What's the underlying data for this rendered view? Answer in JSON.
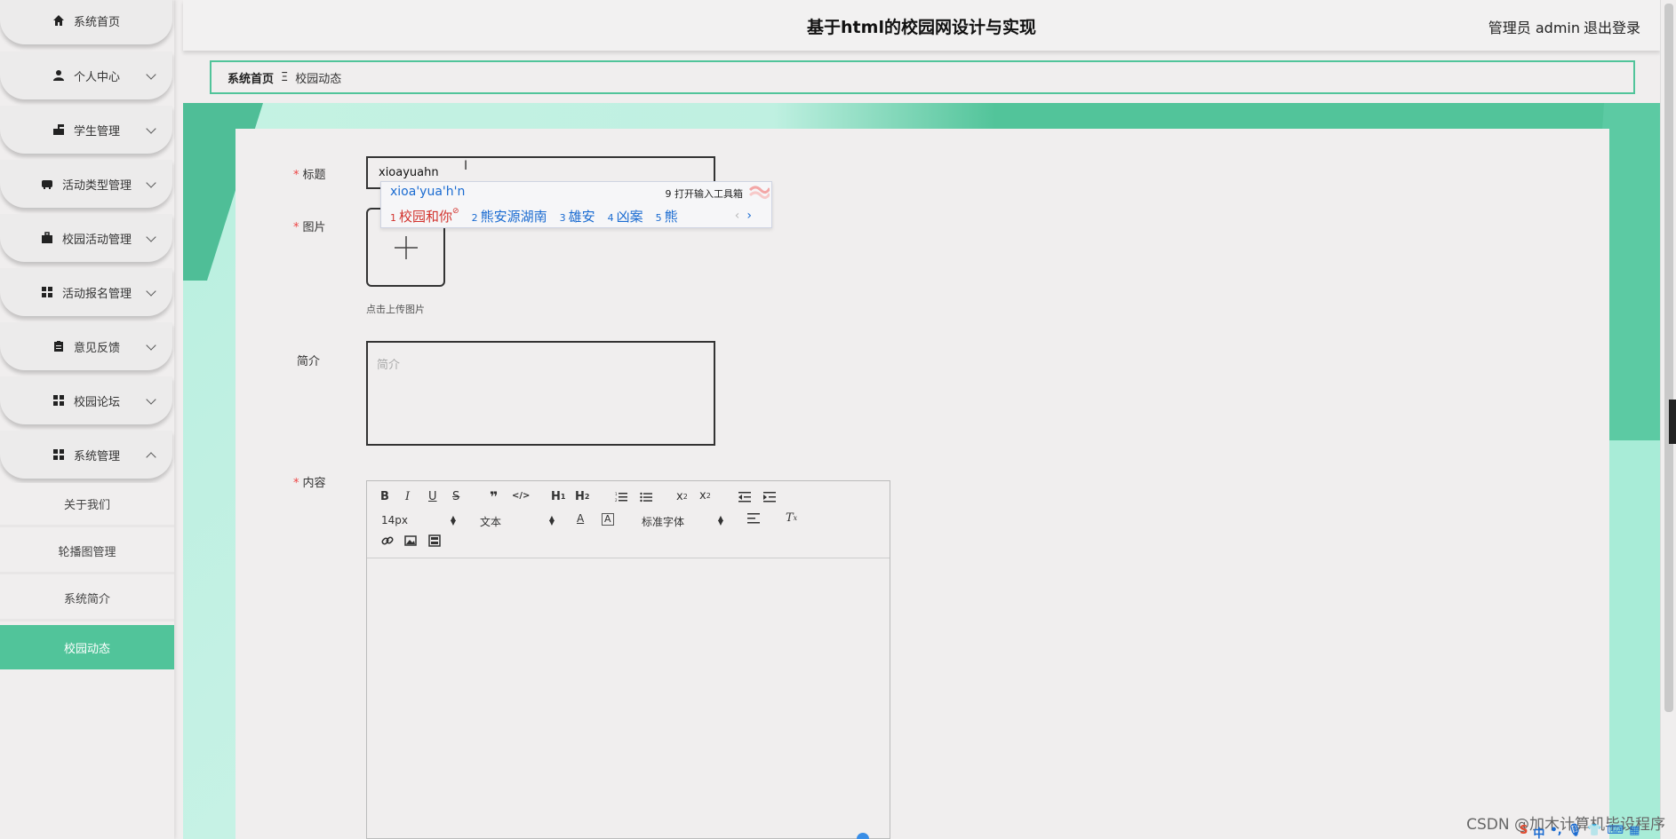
{
  "header": {
    "title": "基于html的校园网设计与实现",
    "admin_label": "管理员 admin",
    "logout_label": "退出登录"
  },
  "sidebar": {
    "items": [
      {
        "label": "系统首页",
        "icon": "home-icon"
      },
      {
        "label": "个人中心",
        "icon": "user-icon"
      },
      {
        "label": "学生管理",
        "icon": "student-icon"
      },
      {
        "label": "活动类型管理",
        "icon": "tag-icon"
      },
      {
        "label": "校园活动管理",
        "icon": "briefcase-icon"
      },
      {
        "label": "活动报名管理",
        "icon": "grid-icon"
      },
      {
        "label": "意见反馈",
        "icon": "clipboard-icon"
      },
      {
        "label": "校园论坛",
        "icon": "grid-icon"
      },
      {
        "label": "系统管理",
        "icon": "grid-icon"
      }
    ],
    "sub_items": [
      {
        "label": "关于我们"
      },
      {
        "label": "轮播图管理"
      },
      {
        "label": "系统简介"
      },
      {
        "label": "校园动态"
      }
    ]
  },
  "breadcrumb": {
    "home": "系统首页",
    "separator": "Ξ",
    "current": "校园动态"
  },
  "form": {
    "title_label": "标题",
    "title_value": "xioayuahn",
    "image_label": "图片",
    "upload_hint": "点击上传图片",
    "intro_label": "简介",
    "intro_placeholder": "简介",
    "content_label": "内容"
  },
  "ime": {
    "pinyin": "xioa'yua'h'n",
    "toolbox": "9 打开输入工具箱",
    "candidates": [
      {
        "n": "1",
        "text": "校园和你"
      },
      {
        "n": "2",
        "text": "熊安源湖南"
      },
      {
        "n": "3",
        "text": "雄安"
      },
      {
        "n": "4",
        "text": "凶案"
      },
      {
        "n": "5",
        "text": "熊"
      }
    ],
    "prev": "‹",
    "next": "›"
  },
  "editor": {
    "font_size": "14px",
    "block_format": "文本",
    "font_family": "标准字体"
  },
  "watermark": "CSDN @加木计算机毕设程序",
  "colors": {
    "accent": "#51c49a",
    "border": "#333333",
    "required": "#ee4444"
  }
}
